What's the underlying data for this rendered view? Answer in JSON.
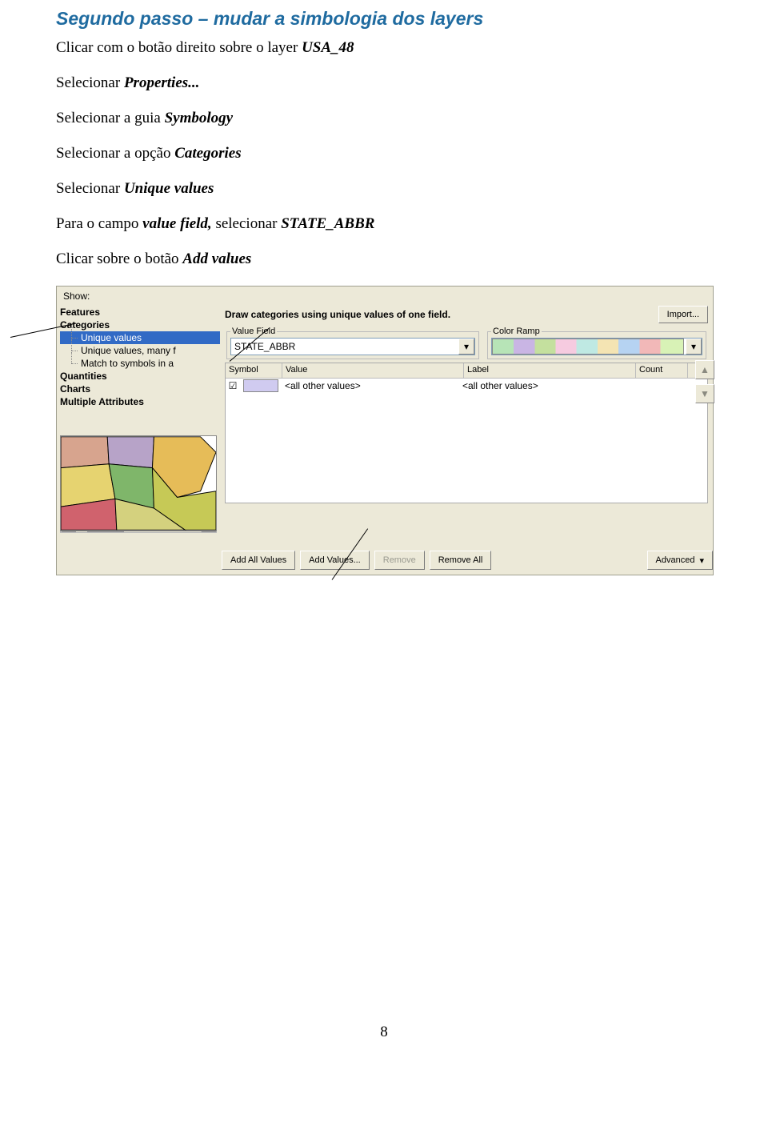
{
  "doc": {
    "heading": "Segundo passo – mudar a simbologia dos layers",
    "p1a": "Clicar com o botão direito sobre o layer ",
    "p1b": "USA_48",
    "p2a": "Selecionar ",
    "p2b": "Properties...",
    "p3a": "Selecionar a guia ",
    "p3b": "Symbology",
    "p4a": "Selecionar a opção ",
    "p4b": "Categories",
    "p5a": "Selecionar ",
    "p5b": "Unique values",
    "p6a": "Para o campo ",
    "p6b": "value field,",
    "p6c": " selecionar ",
    "p6d": "STATE_ABBR",
    "p7a": "Clicar sobre o botão ",
    "p7b": "Add values",
    "page_num": "8"
  },
  "dlg": {
    "show_label": "Show:",
    "import_btn": "Import...",
    "right_title": "Draw categories using unique values of one field.",
    "valuefield_legend": "Value Field",
    "valuefield_value": "STATE_ABBR",
    "colorramp_legend": "Color Ramp",
    "tree": {
      "features": "Features",
      "categories": "Categories",
      "unique_values": "Unique values",
      "unique_values_many": "Unique values, many f",
      "match_symbols": "Match to symbols in a",
      "quantities": "Quantities",
      "charts": "Charts",
      "multiple_attr": "Multiple Attributes"
    },
    "cols": {
      "symbol": "Symbol",
      "value": "Value",
      "label": "Label",
      "count": "Count"
    },
    "row_all_other": "<all other values>",
    "buttons": {
      "add_all": "Add All Values",
      "add_values": "Add Values...",
      "remove": "Remove",
      "remove_all": "Remove All",
      "advanced": "Advanced"
    }
  }
}
